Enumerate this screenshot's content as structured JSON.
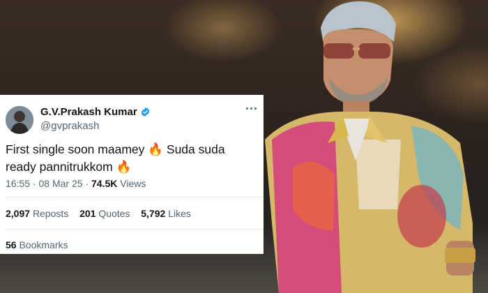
{
  "tweet": {
    "display_name": "G.V.Prakash Kumar",
    "handle": "@gvprakash",
    "text_line1": "First single soon maamey 🔥 Suda suda",
    "text_line2": "ready pannitrukkom 🔥",
    "time": "16:55",
    "separator": "·",
    "date": "08 Mar 25",
    "views_count": "74.5K",
    "views_label": "Views",
    "reposts_count": "2,097",
    "reposts_label": "Reposts",
    "quotes_count": "201",
    "quotes_label": "Quotes",
    "likes_count": "5,792",
    "likes_label": "Likes",
    "bookmarks_count": "56",
    "bookmarks_label": "Bookmarks"
  },
  "icons": {
    "verified": "verified-badge-icon",
    "more": "more-options-icon"
  },
  "colors": {
    "verified_blue": "#1d9bf0",
    "text_primary": "#0f1419",
    "text_secondary": "#536471"
  }
}
